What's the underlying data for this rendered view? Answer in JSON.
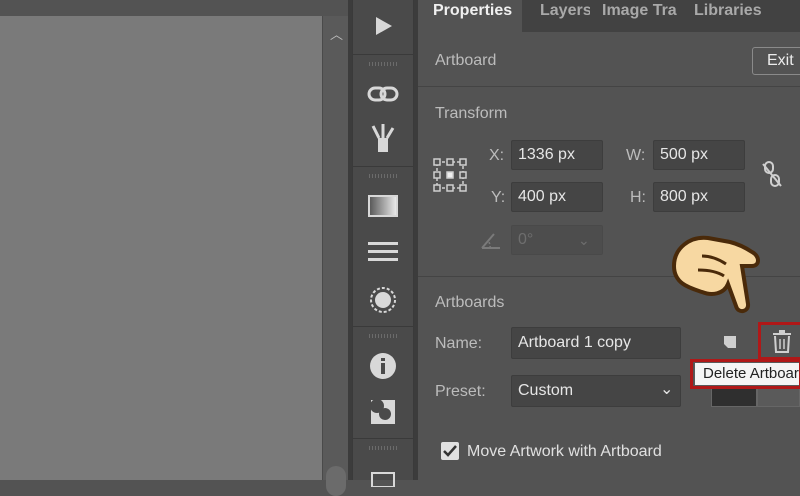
{
  "tabs": {
    "properties": "Properties",
    "layers": "Layers",
    "image_trace": "Image Tra",
    "libraries": "Libraries"
  },
  "artboard": {
    "title": "Artboard",
    "exit_label": "Exit"
  },
  "transform": {
    "title": "Transform",
    "x_label": "X:",
    "x_value": "1336 px",
    "y_label": "Y:",
    "y_value": "400 px",
    "w_label": "W:",
    "w_value": "500 px",
    "h_label": "H:",
    "h_value": "800 px",
    "rotate_value": "0°"
  },
  "artboards": {
    "title": "Artboards",
    "name_label": "Name:",
    "name_value": "Artboard 1 copy",
    "preset_label": "Preset:",
    "preset_value": "Custom",
    "delete_tooltip": "Delete Artboard",
    "move_artwork_label": "Move Artwork with Artboard",
    "move_artwork_checked": true
  },
  "colors": {
    "panel_bg": "#535353",
    "highlight": "#b01818",
    "canvas": "#7a7a7a"
  }
}
